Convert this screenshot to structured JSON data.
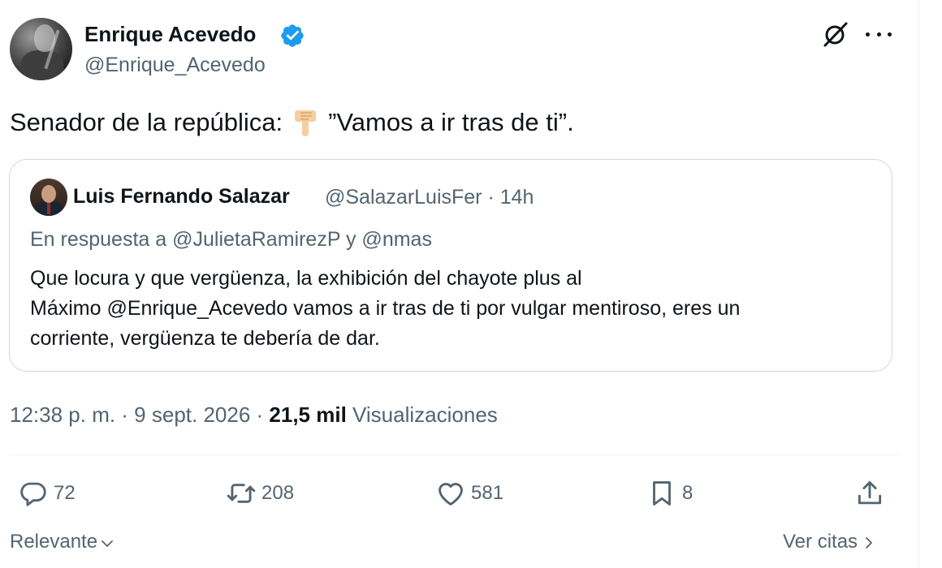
{
  "author": {
    "name": "Enrique Acevedo",
    "handle": "@Enrique_Acevedo"
  },
  "tweet": {
    "text_before": "Senador de la república:",
    "emoji": "backhand-index-pointing-down",
    "text_after": "”Vamos a ir tras de ti”."
  },
  "quoted": {
    "name": "Luis Fernando Salazar",
    "meta": "@SalazarLuisFer · 14h",
    "reply_to": "En respuesta a @JulietaRamirezP y @nmas",
    "lines": [
      "Que locura y que vergüenza, la exhibición del chayote plus al",
      "Máximo  @Enrique_Acevedo vamos a ir tras de ti por vulgar mentiroso, eres un",
      "corriente, vergüenza te debería de dar."
    ]
  },
  "timestamp": {
    "datetime": "12:38 p. m. · 9 sept. 2026 · ",
    "views_count": "21,5 mil",
    "views_label": " Visualizaciones"
  },
  "actions": {
    "replies": "72",
    "reposts": "208",
    "likes": "581",
    "bookmarks": "8"
  },
  "footer": {
    "sort_label": "Relevante",
    "quotes_link": "Ver citas"
  },
  "colors": {
    "verified": "#1d9bf0",
    "secondary_text": "#536471",
    "border": "#cfd9de"
  },
  "icons": [
    "verified-badge-icon",
    "grok-icon",
    "more-icon",
    "reply-icon",
    "repost-icon",
    "like-icon",
    "bookmark-icon",
    "share-icon",
    "chevron-down-icon",
    "chevron-right-icon"
  ]
}
